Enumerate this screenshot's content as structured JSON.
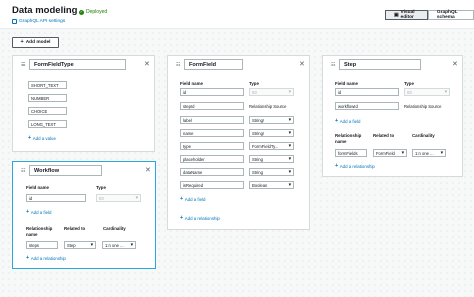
{
  "header": {
    "title": "Data modeling",
    "status": "Deployed",
    "api_link": "GraphQL API settings",
    "view_toggle": [
      "Visual editor",
      "GraphQL schema"
    ]
  },
  "toolbar": {
    "add_model": "Add model"
  },
  "cards": {
    "formfieldtype": {
      "name": "FormFieldType",
      "values": [
        "SHORT_TEXT",
        "NUMBER",
        "CHOICE",
        "LONG_TEXT"
      ],
      "add_value": "Add a value"
    },
    "workflow": {
      "name": "Workflow",
      "field_name_h": "Field name",
      "type_h": "Type",
      "fields": [
        {
          "name": "id",
          "type": "ID!"
        }
      ],
      "add_field": "Add a field",
      "rel_name_h": "Relationship name",
      "related_h": "Related to",
      "card_h": "Cardinality",
      "relationships": [
        {
          "name": "steps",
          "related": "Step",
          "cardinality": "1:n one ..."
        }
      ],
      "add_rel": "Add a relationship"
    },
    "formfield": {
      "name": "FormField",
      "field_name_h": "Field name",
      "type_h": "Type",
      "fields": [
        {
          "name": "id",
          "type": "ID!"
        },
        {
          "name": "stepId",
          "type": "Relationship Source"
        },
        {
          "name": "label",
          "type": "String!"
        },
        {
          "name": "name",
          "type": "String!"
        },
        {
          "name": "type",
          "type": "FormFieldTy..."
        },
        {
          "name": "placeholder",
          "type": "String"
        },
        {
          "name": "dataName",
          "type": "String"
        },
        {
          "name": "isRequired",
          "type": "Boolean"
        }
      ],
      "add_field": "Add a field",
      "add_rel": "Add a relationship"
    },
    "step": {
      "name": "Step",
      "field_name_h": "Field name",
      "type_h": "Type",
      "fields": [
        {
          "name": "id",
          "type": "ID!"
        },
        {
          "name": "workflowId",
          "type": "Relationship Source"
        }
      ],
      "add_field": "Add a field",
      "rel_name_h": "Relationship name",
      "related_h": "Related to",
      "card_h": "Cardinality",
      "relationships": [
        {
          "name": "formFields",
          "related": "FormField",
          "cardinality": "1:n one ..."
        }
      ],
      "add_rel": "Add a relationship"
    }
  }
}
